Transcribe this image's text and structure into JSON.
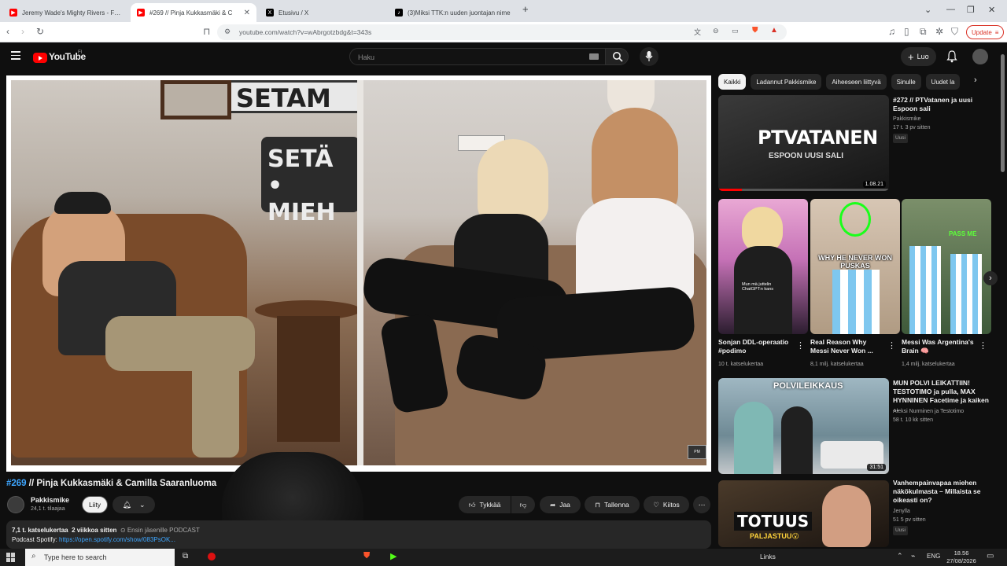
{
  "browser": {
    "tabs": [
      {
        "title": "Jeremy Wade's Mighty Rivers - Full E",
        "active": false,
        "icon": "youtube-favicon"
      },
      {
        "title": "#269 // Pinja Kukkasmäki & C",
        "active": true,
        "icon": "youtube-favicon"
      },
      {
        "title": "Etusivu / X",
        "active": false,
        "icon": "x-favicon"
      },
      {
        "title": "(3)Miksi TTK:n uuden juontajan nime",
        "active": false,
        "icon": "tiktok-favicon"
      }
    ],
    "url": "youtube.com/watch?v=wAbrgotzbdg&t=343s",
    "update_label": "Update"
  },
  "masthead": {
    "logo_text": "YouTube",
    "region": "FI",
    "search_placeholder": "Haku",
    "create_label": "Luo"
  },
  "video": {
    "title_hash": "#269",
    "title_rest": " // Pinja Kukkasmäki & Camilla Saaranluoma",
    "channel": "Pakkismike",
    "subscribers": "24,1 t. tilaajaa",
    "join_label": "Liity",
    "actions": {
      "like": "Tykkää",
      "share": "Jaa",
      "save": "Tallenna",
      "thanks": "Kiitos"
    },
    "description": {
      "views": "7,1 t. katselukertaa",
      "age": "2 viikkoa sitten",
      "tags": "Ensin jäsenille PODCAST",
      "line2_prefix": "Podcast Spotify: ",
      "line2_link": "https://open.spotify.com/show/083PsOK..."
    },
    "sign_text_top": "SETAM",
    "sign_text_main_1": "SETÄ",
    "sign_text_main_2": "• MIEH"
  },
  "sidebar": {
    "chips": [
      "Kaikki",
      "Ladannut Pakkismike",
      "Aiheeseen liittyvä",
      "Sinulle",
      "Uudet la"
    ],
    "video1": {
      "title": "#272 // PTVatanen ja uusi Espoon sali",
      "channel": "Pakkismike",
      "meta": "17 t.  3 pv sitten",
      "badge": "Uusi",
      "duration": "1.08.21",
      "thumb_text": "PTVATANEN",
      "thumb_sub": "ESPOON UUSI SALI"
    },
    "shorts": [
      {
        "title": "Sonjan DDL-operaatio #podimo",
        "views": "10 t. katselukertaa",
        "overlay": "Mun mä juttelin ChatGPT:n kans"
      },
      {
        "title": "Real Reason Why Messi Never Won ...",
        "views": "8,1 milj. katselukertaa",
        "overlay": "WHY HE NEVER WON PUSKAS"
      },
      {
        "title": "Messi Was Argentina's Brain 🧠",
        "views": "1,4 milj. katselukertaa",
        "overlay": "PASS ME"
      }
    ],
    "video2": {
      "title": "MUN POLVI LEIKATTIIN! TESTOTIMO ja pulla, MAX HYNNINEN Facetime ja kaiken ...",
      "channel": "Aleksi Nurminen ja Testotimo",
      "meta": "58 t.  10 kk sitten",
      "duration": "31:51",
      "thumb_text": "POLVILEIKKAUS"
    },
    "video3": {
      "title": "Vanhempainvapaa miehen näkökulmasta – Millaista se oikeasti on?",
      "channel": "Jenylla",
      "meta": "51  5 pv sitten",
      "badge": "Uusi",
      "thumb_text": "TOTUUS",
      "thumb_sub": "PALJASTUU😮"
    }
  },
  "taskbar": {
    "search_placeholder": "Type here to search",
    "links": "Links",
    "lang": "ENG",
    "time": "18.56",
    "date": "27/08/2026"
  },
  "colors": {
    "accent_red": "#ff0000",
    "link_blue": "#3ea6ff",
    "bg": "#0f0f0f"
  }
}
